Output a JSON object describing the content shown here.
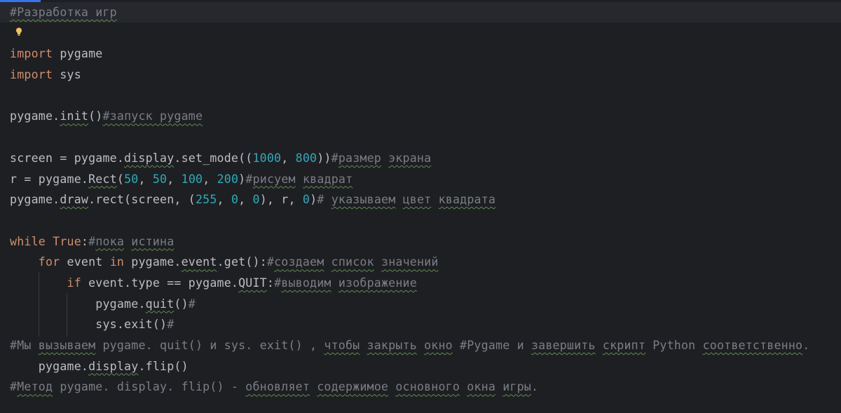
{
  "editor": {
    "accent_color": "#3574f0",
    "bulb_icon": "lightbulb-icon",
    "lines": {
      "l1": "#Разработка игр",
      "l3": {
        "kw": "import",
        "name": " pygame"
      },
      "l4": {
        "kw": "import",
        "name": " sys"
      },
      "l6": {
        "a": "pygame.",
        "fn": "init",
        "b": "()",
        "c": "#запуск pygame"
      },
      "l8": {
        "a": "screen = pygame.",
        "m": "display",
        "b": ".set_mode((",
        "n1": "1000",
        "s1": ", ",
        "n2": "800",
        "e": "))",
        "c1": "#",
        "c2": "размер",
        "c3": " ",
        "c4": "экрана"
      },
      "l9": {
        "a": "r = pygame.",
        "m": "Rect",
        "b": "(",
        "n1": "50",
        "s1": ", ",
        "n2": "50",
        "s2": ", ",
        "n3": "100",
        "s3": ", ",
        "n4": "200",
        "e": ")",
        "c1": "#",
        "c2": "рисуем",
        "c3": " ",
        "c4": "квадрат"
      },
      "l10": {
        "a": "pygame.",
        "m": "draw",
        "b": ".rect(screen, (",
        "n1": "255",
        "s1": ", ",
        "n2": "0",
        "s2": ", ",
        "n3": "0",
        "s3": "), r, ",
        "n4": "0",
        "e": ")",
        "c1": "# ",
        "c2": "указываем",
        "c3": " ",
        "c4": "цвет",
        "c5": " ",
        "c6": "квадрата"
      },
      "l12": {
        "kw": "while",
        "sp": " ",
        "tr": "True",
        "col": ":",
        "c1": "#",
        "c2": "пока",
        "c3": " ",
        "c4": "истина"
      },
      "l13": {
        "kw1": "for",
        "a": " event ",
        "kw2": "in",
        "b": " pygame.",
        "m": "event",
        "d": ".get():",
        "c1": "#",
        "c2": "создаем",
        "c3": " ",
        "c4": "список",
        "c5": " ",
        "c6": "значений"
      },
      "l14": {
        "kw": "if",
        "a": " event.type == pygame.",
        "m": "QUIT",
        "col": ":",
        "c1": "#",
        "c2": "выводим",
        "c3": " ",
        "c4": "изображение"
      },
      "l15": {
        "a": "pygame.",
        "m": "quit",
        "b": "()",
        "c": "#"
      },
      "l16": {
        "a": "sys.exit()",
        "c": "#"
      },
      "l17": {
        "p1": "#Мы ",
        "w1": "вызываем",
        "p2": " pygame. quit() и sys. exit() , ",
        "w2": "чтобы",
        "p3": " ",
        "w3": "закрыть",
        "p4": " ",
        "w4": "окно",
        "p5": " #Pygame и ",
        "w5": "завершить",
        "p6": " ",
        "w6": "скрипт",
        "p7": " Python ",
        "w7": "соответственно",
        "p8": "."
      },
      "l18": {
        "a": "pygame.",
        "m": "display",
        "b": ".flip()"
      },
      "l19": {
        "p1": "#",
        "w1": "Метод",
        "p2": " pygame. display. flip() - ",
        "w2": "обновляет",
        "p3": " ",
        "w3": "содержимое",
        "p4": " ",
        "w4": "основного",
        "p5": " ",
        "w5": "окна",
        "p6": " ",
        "w6": "игры",
        "p7": "."
      }
    }
  }
}
